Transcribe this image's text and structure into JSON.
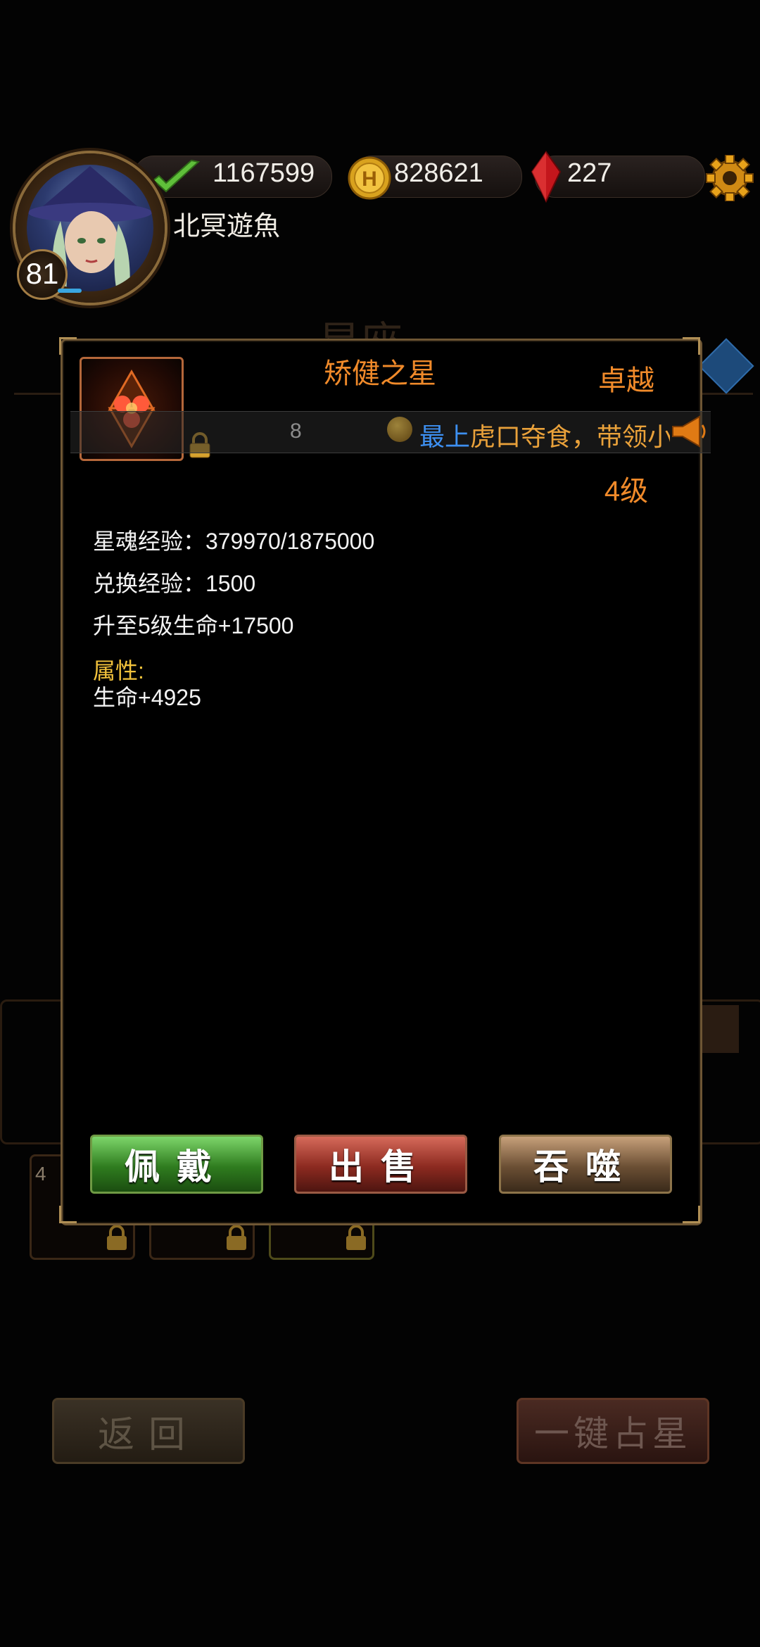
{
  "hud": {
    "stamina": "1167599",
    "gold": "828621",
    "gems": "227",
    "player_name": "北冥遊魚",
    "player_level": "81"
  },
  "dialog": {
    "title": "矫健之星",
    "quality": "卓越",
    "level": "4级",
    "broadcast": {
      "count": "8",
      "highlight": "最上",
      "message": "虎口夺食，带领小"
    },
    "star_soul_exp": "星魂经验：379970/1875000",
    "exchange_exp": "兑换经验：1500",
    "upgrade_info": "升至5级生命+17500",
    "attributes_label": "属性:",
    "attribute_value": "生命+4925",
    "buttons": {
      "equip": "佩戴",
      "sell": "出售",
      "devour": "吞噬"
    }
  },
  "background": {
    "slot_count": "4"
  },
  "bottom": {
    "back": "返回",
    "one_click": "一键占星"
  },
  "colors": {
    "accent_orange": "#f08a2a",
    "attr_yellow": "#f3c33c",
    "link_blue": "#3d8ff0"
  }
}
